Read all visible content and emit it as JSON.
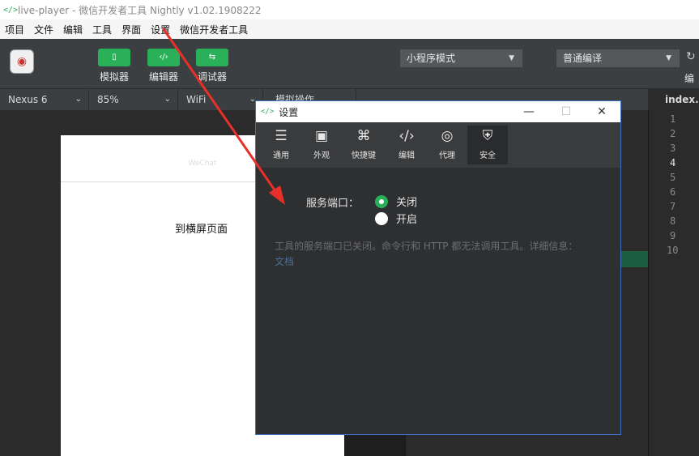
{
  "window": {
    "title": "live-player - 微信开发者工具 Nightly v1.02.1908222",
    "icon": "</>"
  },
  "menubar": {
    "items": [
      "项目",
      "文件",
      "编辑",
      "工具",
      "界面",
      "设置",
      "微信开发者工具"
    ]
  },
  "toolbar": {
    "buttons": [
      {
        "label": "模拟器",
        "icon": "phone-icon"
      },
      {
        "label": "编辑器",
        "icon": "code-icon"
      },
      {
        "label": "调试器",
        "icon": "debug-icon"
      }
    ],
    "mode_select": "小程序模式",
    "compile_select": "普通编译",
    "compile_label": "编"
  },
  "devicebar": {
    "device": "Nexus 6",
    "zoom": "85%",
    "network": "WiFi",
    "ops": "模拟操作"
  },
  "editor": {
    "file_tab": "index.w",
    "line_numbers": [
      "1",
      "2",
      "3",
      "4",
      "5",
      "6",
      "7",
      "8",
      "9",
      "10"
    ],
    "active_line": "4"
  },
  "simulator": {
    "nav_title": "WeChat",
    "text": "到横屏页面"
  },
  "dialog": {
    "title": "设置",
    "icon": "</>",
    "tabs": [
      {
        "label": "通用",
        "icon": "sliders-icon"
      },
      {
        "label": "外观",
        "icon": "window-icon"
      },
      {
        "label": "快捷键",
        "icon": "command-icon"
      },
      {
        "label": "编辑",
        "icon": "code-icon"
      },
      {
        "label": "代理",
        "icon": "globe-icon"
      },
      {
        "label": "安全",
        "icon": "shield-icon"
      }
    ],
    "active_tab": "安全",
    "port_label": "服务端口：",
    "options": [
      {
        "label": "关闭",
        "selected": true
      },
      {
        "label": "开启",
        "selected": false
      }
    ],
    "description": "工具的服务端口已关闭。命令行和 HTTP 都无法调用工具。详细信息：",
    "link": "文档"
  },
  "colors": {
    "accent": "#2bb05a",
    "arrow": "#e8302a",
    "dialog_border": "#3b73c2"
  }
}
